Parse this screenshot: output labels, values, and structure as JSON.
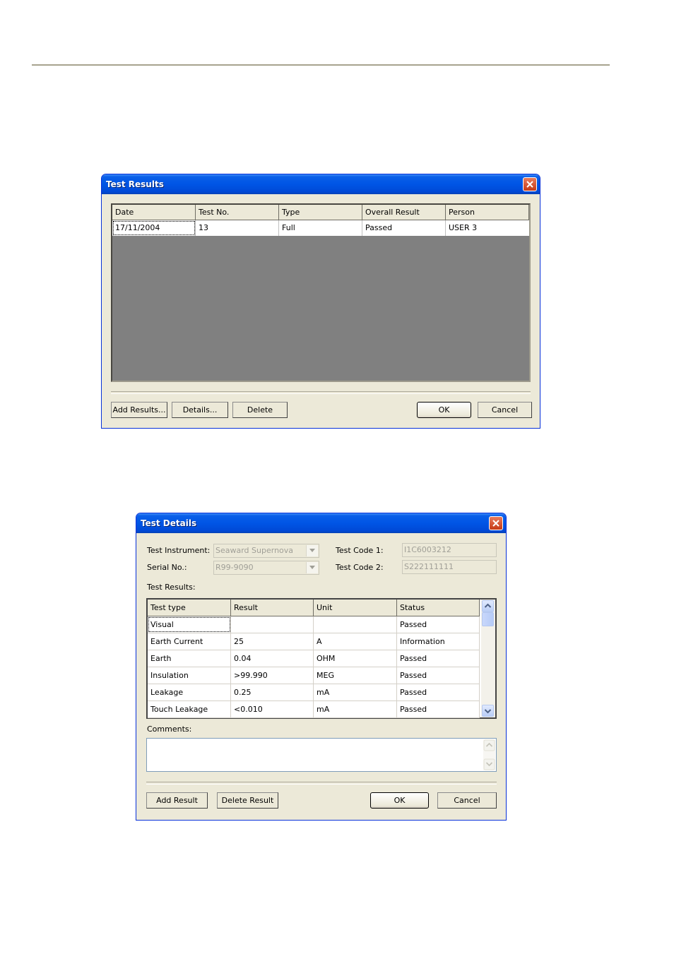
{
  "test_results": {
    "title": "Test Results",
    "columns": [
      "Date",
      "Test No.",
      "Type",
      "Overall Result",
      "Person"
    ],
    "rows": [
      [
        "17/11/2004",
        "13",
        "Full",
        "Passed",
        "USER 3"
      ]
    ],
    "buttons": {
      "add_results": "Add Results...",
      "details": "Details...",
      "delete": "Delete",
      "ok": "OK",
      "cancel": "Cancel"
    }
  },
  "test_details": {
    "title": "Test Details",
    "test_instrument_label": "Test Instrument:",
    "test_instrument_value": "Seaward Supernova",
    "serial_no_label": "Serial No.:",
    "serial_no_value": "R99-9090",
    "test_code_1_label": "Test Code 1:",
    "test_code_1_value": "I1C6003212",
    "test_code_2_label": "Test Code 2:",
    "test_code_2_value": "S222111111",
    "test_results_label": "Test Results:",
    "columns": [
      "Test type",
      "Result",
      "Unit",
      "Status"
    ],
    "rows": [
      [
        "Visual",
        "",
        "",
        "Passed"
      ],
      [
        "Earth Current",
        "25",
        "A",
        "Information"
      ],
      [
        "Earth",
        "0.04",
        "OHM",
        "Passed"
      ],
      [
        "Insulation",
        ">99.990",
        "MEG",
        "Passed"
      ],
      [
        "Leakage",
        "0.25",
        "mA",
        "Passed"
      ],
      [
        "Touch Leakage",
        "<0.010",
        "mA",
        "Passed"
      ]
    ],
    "comments_label": "Comments:",
    "comments_value": "",
    "buttons": {
      "add_result": "Add Result",
      "delete_result": "Delete Result",
      "ok": "OK",
      "cancel": "Cancel"
    }
  }
}
